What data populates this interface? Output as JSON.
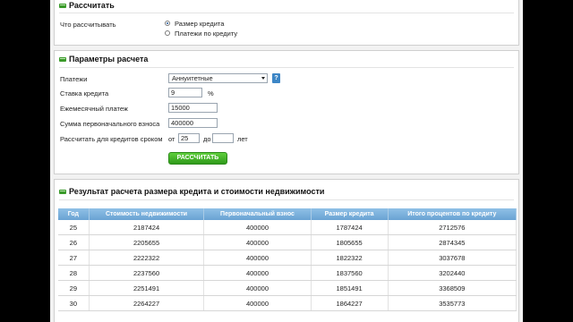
{
  "calc": {
    "title": "Рассчитать",
    "what_label": "Что рассчитывать",
    "options": [
      {
        "label": "Размер кредита",
        "selected": true
      },
      {
        "label": "Платежи по кредиту",
        "selected": false
      }
    ]
  },
  "params": {
    "title": "Параметры расчета",
    "payments_label": "Платежи",
    "payments_value": "Аннуитетные",
    "help": "?",
    "rate_label": "Ставка кредита",
    "rate_value": "9",
    "rate_unit": "%",
    "monthly_label": "Ежемесячный платеж",
    "monthly_value": "15000",
    "down_label": "Сумма первоначального взноса",
    "down_value": "400000",
    "term_label": "Рассчитать для кредитов сроком",
    "from_label": "от",
    "from_value": "25",
    "to_label": "до",
    "to_value": "",
    "years_label": "лет",
    "button": "РАССЧИТАТЬ"
  },
  "result": {
    "title": "Результат расчета размера кредита и стоимости недвижимости",
    "columns": [
      "Год",
      "Стоимость недвижимости",
      "Первоначальный взнос",
      "Размер кредита",
      "Итого процентов по кредиту"
    ],
    "rows": [
      [
        "25",
        "2187424",
        "400000",
        "1787424",
        "2712576"
      ],
      [
        "26",
        "2205655",
        "400000",
        "1805655",
        "2874345"
      ],
      [
        "27",
        "2222322",
        "400000",
        "1822322",
        "3037678"
      ],
      [
        "28",
        "2237560",
        "400000",
        "1837560",
        "3202440"
      ],
      [
        "29",
        "2251491",
        "400000",
        "1851491",
        "3368509"
      ],
      [
        "30",
        "2264227",
        "400000",
        "1864227",
        "3535773"
      ]
    ]
  }
}
